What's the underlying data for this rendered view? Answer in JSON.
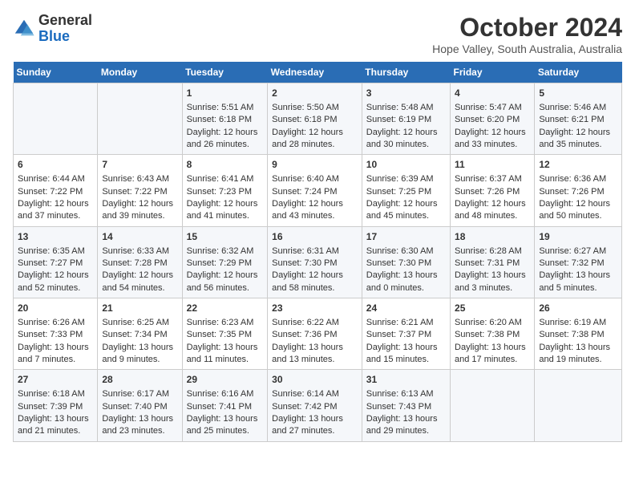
{
  "header": {
    "logo": {
      "general": "General",
      "blue": "Blue"
    },
    "title": "October 2024",
    "location": "Hope Valley, South Australia, Australia"
  },
  "calendar": {
    "days_of_week": [
      "Sunday",
      "Monday",
      "Tuesday",
      "Wednesday",
      "Thursday",
      "Friday",
      "Saturday"
    ],
    "weeks": [
      [
        {
          "day": "",
          "content": ""
        },
        {
          "day": "",
          "content": ""
        },
        {
          "day": "1",
          "sunrise": "Sunrise: 5:51 AM",
          "sunset": "Sunset: 6:18 PM",
          "daylight": "Daylight: 12 hours and 26 minutes."
        },
        {
          "day": "2",
          "sunrise": "Sunrise: 5:50 AM",
          "sunset": "Sunset: 6:18 PM",
          "daylight": "Daylight: 12 hours and 28 minutes."
        },
        {
          "day": "3",
          "sunrise": "Sunrise: 5:48 AM",
          "sunset": "Sunset: 6:19 PM",
          "daylight": "Daylight: 12 hours and 30 minutes."
        },
        {
          "day": "4",
          "sunrise": "Sunrise: 5:47 AM",
          "sunset": "Sunset: 6:20 PM",
          "daylight": "Daylight: 12 hours and 33 minutes."
        },
        {
          "day": "5",
          "sunrise": "Sunrise: 5:46 AM",
          "sunset": "Sunset: 6:21 PM",
          "daylight": "Daylight: 12 hours and 35 minutes."
        }
      ],
      [
        {
          "day": "6",
          "sunrise": "Sunrise: 6:44 AM",
          "sunset": "Sunset: 7:22 PM",
          "daylight": "Daylight: 12 hours and 37 minutes."
        },
        {
          "day": "7",
          "sunrise": "Sunrise: 6:43 AM",
          "sunset": "Sunset: 7:22 PM",
          "daylight": "Daylight: 12 hours and 39 minutes."
        },
        {
          "day": "8",
          "sunrise": "Sunrise: 6:41 AM",
          "sunset": "Sunset: 7:23 PM",
          "daylight": "Daylight: 12 hours and 41 minutes."
        },
        {
          "day": "9",
          "sunrise": "Sunrise: 6:40 AM",
          "sunset": "Sunset: 7:24 PM",
          "daylight": "Daylight: 12 hours and 43 minutes."
        },
        {
          "day": "10",
          "sunrise": "Sunrise: 6:39 AM",
          "sunset": "Sunset: 7:25 PM",
          "daylight": "Daylight: 12 hours and 45 minutes."
        },
        {
          "day": "11",
          "sunrise": "Sunrise: 6:37 AM",
          "sunset": "Sunset: 7:26 PM",
          "daylight": "Daylight: 12 hours and 48 minutes."
        },
        {
          "day": "12",
          "sunrise": "Sunrise: 6:36 AM",
          "sunset": "Sunset: 7:26 PM",
          "daylight": "Daylight: 12 hours and 50 minutes."
        }
      ],
      [
        {
          "day": "13",
          "sunrise": "Sunrise: 6:35 AM",
          "sunset": "Sunset: 7:27 PM",
          "daylight": "Daylight: 12 hours and 52 minutes."
        },
        {
          "day": "14",
          "sunrise": "Sunrise: 6:33 AM",
          "sunset": "Sunset: 7:28 PM",
          "daylight": "Daylight: 12 hours and 54 minutes."
        },
        {
          "day": "15",
          "sunrise": "Sunrise: 6:32 AM",
          "sunset": "Sunset: 7:29 PM",
          "daylight": "Daylight: 12 hours and 56 minutes."
        },
        {
          "day": "16",
          "sunrise": "Sunrise: 6:31 AM",
          "sunset": "Sunset: 7:30 PM",
          "daylight": "Daylight: 12 hours and 58 minutes."
        },
        {
          "day": "17",
          "sunrise": "Sunrise: 6:30 AM",
          "sunset": "Sunset: 7:30 PM",
          "daylight": "Daylight: 13 hours and 0 minutes."
        },
        {
          "day": "18",
          "sunrise": "Sunrise: 6:28 AM",
          "sunset": "Sunset: 7:31 PM",
          "daylight": "Daylight: 13 hours and 3 minutes."
        },
        {
          "day": "19",
          "sunrise": "Sunrise: 6:27 AM",
          "sunset": "Sunset: 7:32 PM",
          "daylight": "Daylight: 13 hours and 5 minutes."
        }
      ],
      [
        {
          "day": "20",
          "sunrise": "Sunrise: 6:26 AM",
          "sunset": "Sunset: 7:33 PM",
          "daylight": "Daylight: 13 hours and 7 minutes."
        },
        {
          "day": "21",
          "sunrise": "Sunrise: 6:25 AM",
          "sunset": "Sunset: 7:34 PM",
          "daylight": "Daylight: 13 hours and 9 minutes."
        },
        {
          "day": "22",
          "sunrise": "Sunrise: 6:23 AM",
          "sunset": "Sunset: 7:35 PM",
          "daylight": "Daylight: 13 hours and 11 minutes."
        },
        {
          "day": "23",
          "sunrise": "Sunrise: 6:22 AM",
          "sunset": "Sunset: 7:36 PM",
          "daylight": "Daylight: 13 hours and 13 minutes."
        },
        {
          "day": "24",
          "sunrise": "Sunrise: 6:21 AM",
          "sunset": "Sunset: 7:37 PM",
          "daylight": "Daylight: 13 hours and 15 minutes."
        },
        {
          "day": "25",
          "sunrise": "Sunrise: 6:20 AM",
          "sunset": "Sunset: 7:38 PM",
          "daylight": "Daylight: 13 hours and 17 minutes."
        },
        {
          "day": "26",
          "sunrise": "Sunrise: 6:19 AM",
          "sunset": "Sunset: 7:38 PM",
          "daylight": "Daylight: 13 hours and 19 minutes."
        }
      ],
      [
        {
          "day": "27",
          "sunrise": "Sunrise: 6:18 AM",
          "sunset": "Sunset: 7:39 PM",
          "daylight": "Daylight: 13 hours and 21 minutes."
        },
        {
          "day": "28",
          "sunrise": "Sunrise: 6:17 AM",
          "sunset": "Sunset: 7:40 PM",
          "daylight": "Daylight: 13 hours and 23 minutes."
        },
        {
          "day": "29",
          "sunrise": "Sunrise: 6:16 AM",
          "sunset": "Sunset: 7:41 PM",
          "daylight": "Daylight: 13 hours and 25 minutes."
        },
        {
          "day": "30",
          "sunrise": "Sunrise: 6:14 AM",
          "sunset": "Sunset: 7:42 PM",
          "daylight": "Daylight: 13 hours and 27 minutes."
        },
        {
          "day": "31",
          "sunrise": "Sunrise: 6:13 AM",
          "sunset": "Sunset: 7:43 PM",
          "daylight": "Daylight: 13 hours and 29 minutes."
        },
        {
          "day": "",
          "content": ""
        },
        {
          "day": "",
          "content": ""
        }
      ]
    ]
  }
}
